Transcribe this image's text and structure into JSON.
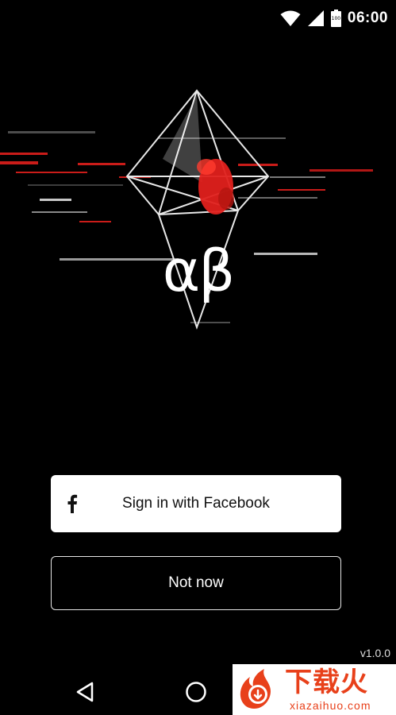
{
  "status_bar": {
    "time": "06:00",
    "battery_level": "100",
    "icons": [
      "wifi-icon",
      "cell-signal-icon",
      "battery-icon"
    ]
  },
  "hero": {
    "logo_text": "αβ",
    "accent_color": "#e0201c"
  },
  "buttons": {
    "facebook_label": "Sign in with Facebook",
    "facebook_icon": "facebook-icon",
    "not_now_label": "Not now"
  },
  "version": "v1.0.0",
  "nav_bar": {
    "icons": [
      "back-icon",
      "home-icon"
    ]
  },
  "watermark": {
    "title": "下载火",
    "url": "xiazaihuo.com",
    "color": "#e8401a"
  }
}
